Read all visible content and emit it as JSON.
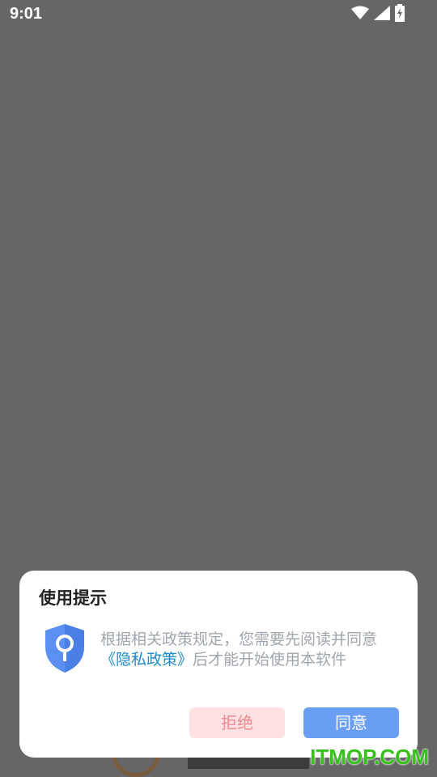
{
  "status_bar": {
    "time": "9:01",
    "icons": [
      "wifi-icon",
      "signal-icon",
      "battery-charging-icon"
    ]
  },
  "background": {
    "watermark": "ITMOP.COM"
  },
  "dialog": {
    "title": "使用提示",
    "message_before": "根据相关政策规定，您需要先阅读并同意",
    "policy_link": "《隐私政策》",
    "message_after": "后才能开始使用本软件",
    "reject_label": "拒绝",
    "agree_label": "同意",
    "icon": "shield-lock-icon"
  },
  "colors": {
    "overlay": "#666666",
    "link": "#1c8ac7",
    "agree_button": "#6a9ef5",
    "reject_button": "#fde1e3"
  }
}
